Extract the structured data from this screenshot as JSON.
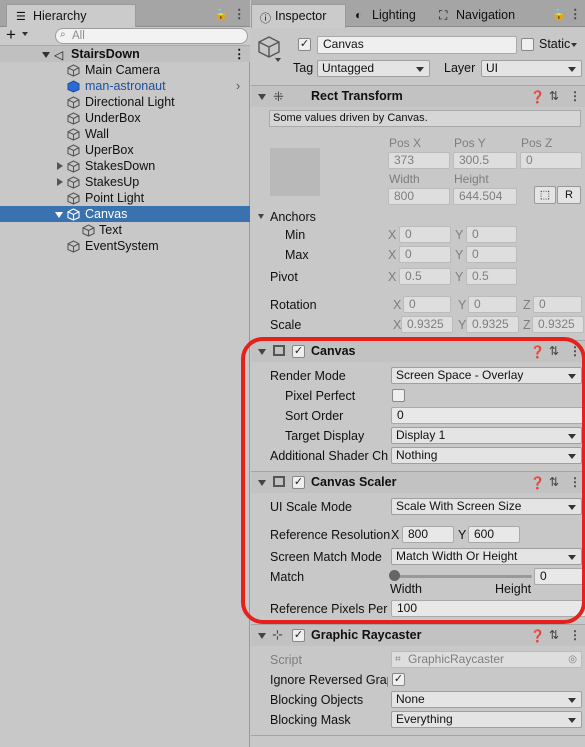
{
  "hierarchy": {
    "tab_label": "Hierarchy",
    "search_placeholder": "All",
    "scene_name": "StairsDown",
    "items": [
      {
        "label": "Main Camera"
      },
      {
        "label": "man-astronaut"
      },
      {
        "label": "Directional Light"
      },
      {
        "label": "UnderBox"
      },
      {
        "label": "Wall"
      },
      {
        "label": "UperBox"
      },
      {
        "label": "StakesDown"
      },
      {
        "label": "StakesUp"
      },
      {
        "label": "Point Light"
      },
      {
        "label": "Canvas"
      },
      {
        "label": "Text"
      },
      {
        "label": "EventSystem"
      }
    ]
  },
  "inspector": {
    "tabs": [
      "Inspector",
      "Lighting",
      "Navigation"
    ],
    "object_name": "Canvas",
    "static_label": "Static",
    "tag_label": "Tag",
    "tag_value": "Untagged",
    "layer_label": "Layer",
    "layer_value": "UI"
  },
  "rect_transform": {
    "title": "Rect Transform",
    "notice": "Some values driven by Canvas.",
    "pos_x_label": "Pos X",
    "pos_y_label": "Pos Y",
    "pos_z_label": "Pos Z",
    "pos_x": "373",
    "pos_y": "300.5",
    "pos_z": "0",
    "width_label": "Width",
    "height_label": "Height",
    "width": "800",
    "height": "644.504",
    "r_button": "R",
    "anchors_label": "Anchors",
    "min_label": "Min",
    "max_label": "Max",
    "min_x": "0",
    "min_y": "0",
    "max_x": "0",
    "max_y": "0",
    "pivot_label": "Pivot",
    "pivot_x": "0.5",
    "pivot_y": "0.5",
    "rotation_label": "Rotation",
    "rot_x": "0",
    "rot_y": "0",
    "rot_z": "0",
    "scale_label": "Scale",
    "scale_x": "0.9325",
    "scale_y": "0.9325",
    "scale_z": "0.9325",
    "x": "X",
    "y": "Y",
    "z": "Z"
  },
  "canvas": {
    "title": "Canvas",
    "render_mode_label": "Render Mode",
    "render_mode": "Screen Space - Overlay",
    "pixel_perfect_label": "Pixel Perfect",
    "sort_order_label": "Sort Order",
    "sort_order": "0",
    "target_display_label": "Target Display",
    "target_display": "Display 1",
    "shader_label": "Additional Shader Ch",
    "shader_value": "Nothing"
  },
  "canvas_scaler": {
    "title": "Canvas Scaler",
    "ui_scale_mode_label": "UI Scale Mode",
    "ui_scale_mode": "Scale With Screen Size",
    "ref_res_label": "Reference Resolution",
    "ref_x": "800",
    "ref_y": "600",
    "match_mode_label": "Screen Match Mode",
    "match_mode": "Match Width Or Height",
    "match_label": "Match",
    "match_value": "0",
    "match_fraction": 0,
    "width_label": "Width",
    "height_label": "Height",
    "ref_ppu_label": "Reference Pixels Per",
    "ref_ppu": "100"
  },
  "graphic_raycaster": {
    "title": "Graphic Raycaster",
    "script_label": "Script",
    "script_value": "GraphicRaycaster",
    "ignore_label": "Ignore Reversed Grap",
    "blocking_objects_label": "Blocking Objects",
    "blocking_objects": "None",
    "blocking_mask_label": "Blocking Mask",
    "blocking_mask": "Everything"
  },
  "colors": {
    "selection": "#3a72b0",
    "highlight": "#e8201d",
    "prefab_text": "#1f4fa0"
  }
}
